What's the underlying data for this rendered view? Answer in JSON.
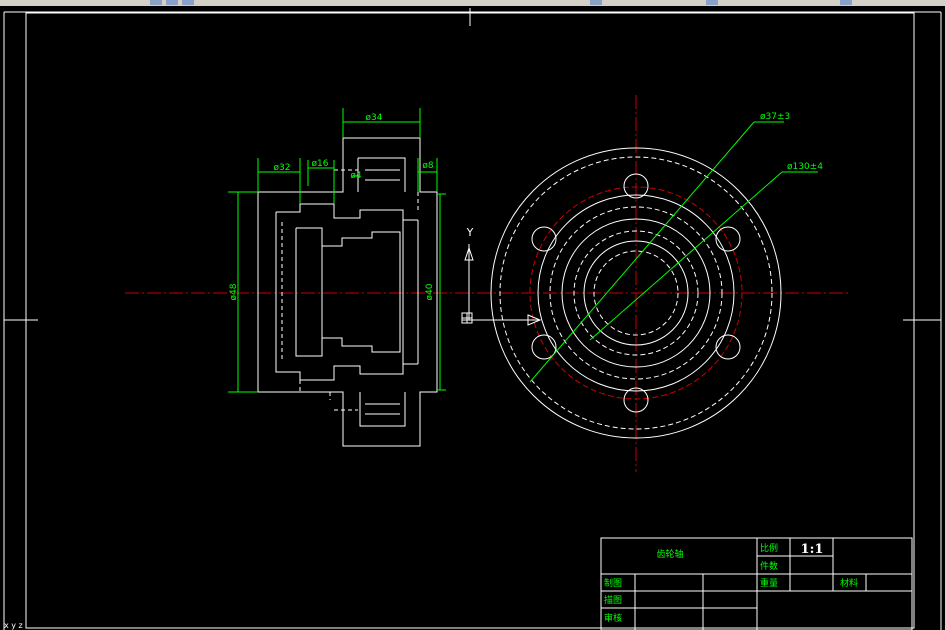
{
  "colors": {
    "background": "#000000",
    "outline": "#ffffff",
    "dimension": "#00ff00",
    "centerline": "#cc0000",
    "hidden": "#ffffff"
  },
  "drawing": {
    "dimensions": {
      "top_width": "ø34",
      "left_step": "ø32",
      "middle_step": "ø16",
      "right_small": "ø8",
      "small_mid": "ø4",
      "left_height": "ø48",
      "right_height": "ø40",
      "leader_1": "ø37±3",
      "leader_2": "ø130±4"
    },
    "ucs": {
      "y_label": "Y"
    }
  },
  "title_block": {
    "part_name": "齿轮轴",
    "scale_label": "比例",
    "scale_value": "1:1",
    "quantity_label": "件数",
    "weight_label": "重量",
    "material_label": "材料",
    "drawn_label": "制图",
    "checked_label": "描图",
    "reviewed_label": "审核"
  },
  "status": {
    "coords": "x  y  z"
  }
}
